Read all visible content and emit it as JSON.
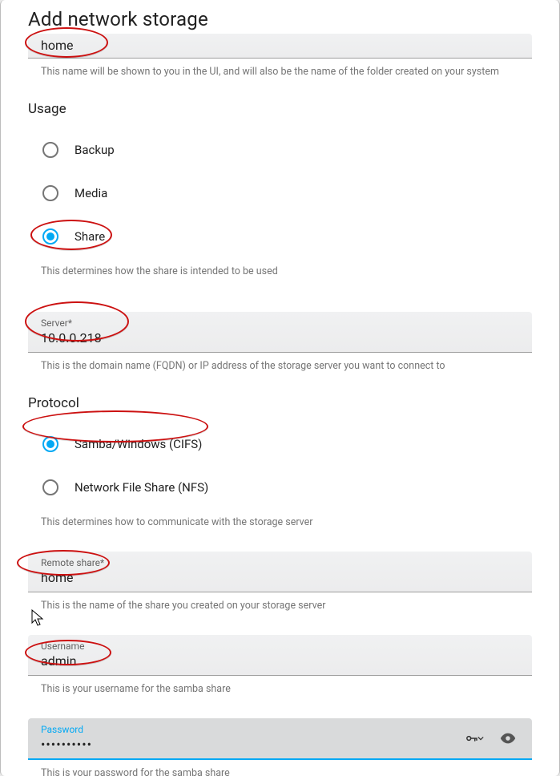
{
  "dialog": {
    "title": "Add network storage"
  },
  "name_field": {
    "value": "home",
    "help": "This name will be shown to you in the UI, and will also be the name of the folder created on your system"
  },
  "usage": {
    "title": "Usage",
    "options": {
      "backup": "Backup",
      "media": "Media",
      "share": "Share"
    },
    "selected": "share",
    "help": "This determines how the share is intended to be used"
  },
  "server_field": {
    "label": "Server*",
    "value": "10.0.0.218",
    "help": "This is the domain name (FQDN) or IP address of the storage server you want to connect to"
  },
  "protocol": {
    "title": "Protocol",
    "options": {
      "cifs": "Samba/Windows (CIFS)",
      "nfs": "Network File Share (NFS)"
    },
    "selected": "cifs",
    "help": "This determines how to communicate with the storage server"
  },
  "remote_share_field": {
    "label": "Remote share*",
    "value": "home",
    "help": "This is the name of the share you created on your storage server"
  },
  "username_field": {
    "label": "Username",
    "value": "admin",
    "help": "This is your username for the samba share"
  },
  "password_field": {
    "label": "Password",
    "mask": "••••••••••",
    "help": "This is your password for the samba share"
  }
}
